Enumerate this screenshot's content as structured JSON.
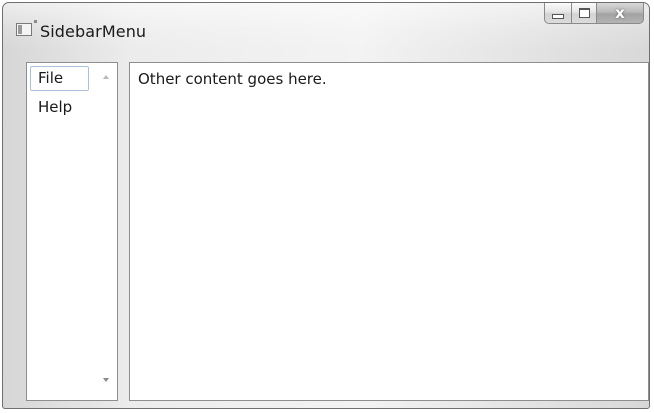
{
  "window": {
    "title": "SidebarMenu",
    "icons": {
      "app": "window-icon",
      "minimize": "minimize-icon",
      "maximize": "maximize-icon",
      "close": "close-icon"
    },
    "close_label": "x"
  },
  "sidebar": {
    "items": [
      {
        "label": "File",
        "selected": true
      },
      {
        "label": "Help",
        "selected": false
      }
    ],
    "scroll_icons": {
      "up": "scroll-up-arrow-icon",
      "down": "scroll-down-arrow-icon"
    }
  },
  "content": {
    "text": "Other content goes here."
  }
}
